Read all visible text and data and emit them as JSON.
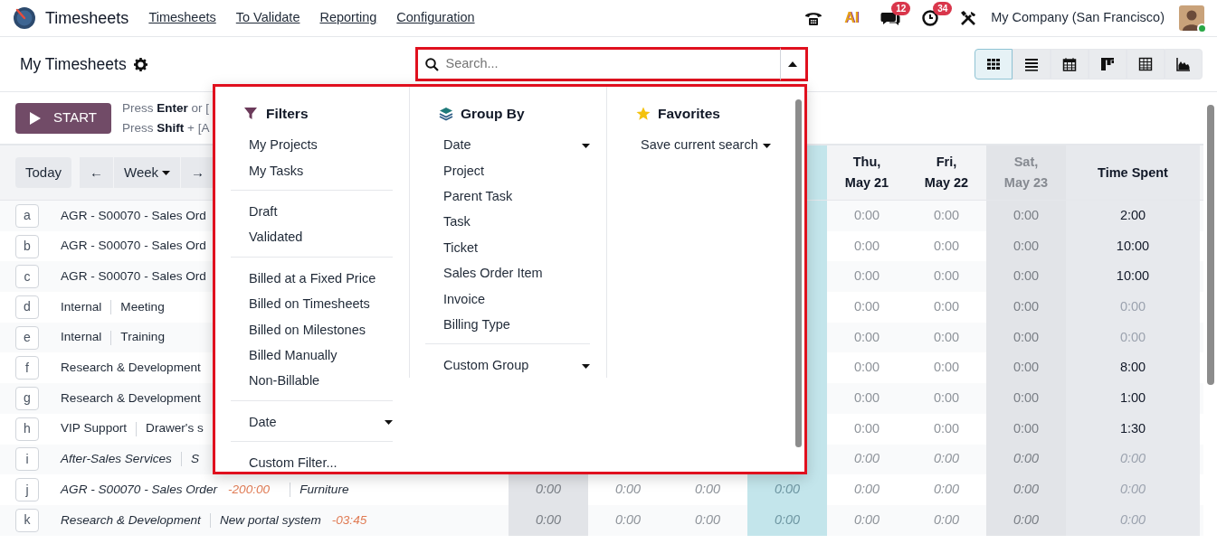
{
  "navbar": {
    "app_name": "Timesheets",
    "menu": [
      "Timesheets",
      "To Validate",
      "Reporting",
      "Configuration"
    ],
    "systray": [
      {
        "kind": "phone"
      },
      {
        "kind": "ai",
        "label": "AI"
      },
      {
        "kind": "chat",
        "badge": "12"
      },
      {
        "kind": "clock",
        "badge": "34"
      },
      {
        "kind": "tools"
      }
    ],
    "company": "My Company (San Francisco)",
    "user": {
      "online": true
    }
  },
  "control_panel": {
    "title": "My Timesheets",
    "search": {
      "placeholder": "Search...",
      "expanded": true
    },
    "views": [
      {
        "kind": "grid",
        "selected": true
      },
      {
        "kind": "list",
        "selected": false
      },
      {
        "kind": "calendar",
        "selected": false
      },
      {
        "kind": "kanban",
        "selected": false
      },
      {
        "kind": "pivot",
        "selected": false
      },
      {
        "kind": "graph",
        "selected": false
      }
    ]
  },
  "timer": {
    "button": "START",
    "hints": [
      "Press **Enter** or [",
      "Press **Shift** + [A"
    ]
  },
  "grid": {
    "toolbar": {
      "today": "Today",
      "prev": "←",
      "range": "Week",
      "next": "→"
    },
    "columns": [
      {
        "weekend": true
      },
      {
        "weekend": false
      },
      {
        "weekend": false
      },
      {
        "today": true
      },
      {
        "label": "Thu,",
        "date": "May 21",
        "weekend": false
      },
      {
        "label": "Fri,",
        "date": "May 22",
        "weekend": false
      },
      {
        "label": "Sat,",
        "date": "May 23",
        "weekend": true
      }
    ],
    "total_header": "Time Spent",
    "rows": [
      {
        "key": "a",
        "kind": "active",
        "segments": [
          {
            "kind": "name",
            "text": "AGR - S00070 - Sales Ord"
          }
        ],
        "hours": [
          "0:00",
          "0:00",
          "0:00"
        ],
        "total": "2:00",
        "total_muted": false
      },
      {
        "key": "b",
        "kind": "active",
        "segments": [
          {
            "kind": "name",
            "text": "AGR - S00070 - Sales Ord"
          }
        ],
        "hours": [
          "0:00",
          "0:00",
          "0:00"
        ],
        "total": "10:00",
        "total_muted": false
      },
      {
        "key": "c",
        "kind": "active",
        "segments": [
          {
            "kind": "name",
            "text": "AGR - S00070 - Sales Ord"
          }
        ],
        "hours": [
          "0:00",
          "0:00",
          "0:00"
        ],
        "total": "10:00",
        "total_muted": false
      },
      {
        "key": "d",
        "kind": "active",
        "segments": [
          {
            "kind": "name",
            "text": "Internal"
          },
          {
            "kind": "name",
            "text": "Meeting"
          }
        ],
        "hours": [
          "0:00",
          "0:00",
          "0:00"
        ],
        "total": "0:00",
        "total_muted": true
      },
      {
        "key": "e",
        "kind": "active",
        "segments": [
          {
            "kind": "name",
            "text": "Internal"
          },
          {
            "kind": "name",
            "text": "Training"
          }
        ],
        "hours": [
          "0:00",
          "0:00",
          "0:00"
        ],
        "total": "0:00",
        "total_muted": true
      },
      {
        "key": "f",
        "kind": "active",
        "segments": [
          {
            "kind": "name",
            "text": "Research & Development"
          }
        ],
        "hours": [
          "0:00",
          "0:00",
          "0:00"
        ],
        "total": "8:00",
        "total_muted": false
      },
      {
        "key": "g",
        "kind": "active",
        "segments": [
          {
            "kind": "name",
            "text": "Research & Development"
          }
        ],
        "hours": [
          "0:00",
          "0:00",
          "0:00"
        ],
        "total": "1:00",
        "total_muted": false
      },
      {
        "key": "h",
        "kind": "active",
        "segments": [
          {
            "kind": "name",
            "text": "VIP Support"
          },
          {
            "kind": "name",
            "text": "Drawer's s"
          }
        ],
        "hours": [
          "0:00",
          "0:00",
          "0:00"
        ],
        "total": "1:30",
        "total_muted": false
      },
      {
        "key": "i",
        "kind": "inactive",
        "segments": [
          {
            "kind": "name",
            "text": "After-Sales Services"
          },
          {
            "kind": "name",
            "text": "S"
          }
        ],
        "hours": [
          "0:00",
          "0:00",
          "0:00"
        ],
        "total": "0:00",
        "total_muted": true
      },
      {
        "key": "j",
        "kind": "inactive",
        "segments": [
          {
            "kind": "name",
            "text": "AGR - S00070 - Sales Order"
          },
          {
            "kind": "remaining",
            "text": "-200:00"
          },
          {
            "kind": "name",
            "text": "Furniture"
          }
        ],
        "hours": [
          "0:00",
          "0:00",
          "0:00",
          "0:00",
          "0:00",
          "0:00",
          "0:00"
        ],
        "total": "0:00",
        "total_muted": true
      },
      {
        "key": "k",
        "kind": "inactive",
        "segments": [
          {
            "kind": "name",
            "text": "Research & Development"
          },
          {
            "kind": "name",
            "text": "New portal system"
          },
          {
            "kind": "remaining",
            "text": "-03:45"
          }
        ],
        "hours": [
          "0:00",
          "0:00",
          "0:00",
          "0:00",
          "0:00",
          "0:00",
          "0:00"
        ],
        "total": "0:00",
        "total_muted": true
      }
    ]
  },
  "search_panel": {
    "filters": {
      "title": "Filters",
      "groups": [
        {
          "items": [
            {
              "label": "My Projects"
            },
            {
              "label": "My Tasks"
            }
          ]
        },
        {
          "items": [
            {
              "label": "Draft"
            },
            {
              "label": "Validated"
            }
          ]
        },
        {
          "items": [
            {
              "label": "Billed at a Fixed Price"
            },
            {
              "label": "Billed on Timesheets"
            },
            {
              "label": "Billed on Milestones"
            },
            {
              "label": "Billed Manually"
            },
            {
              "label": "Non-Billable"
            }
          ]
        },
        {
          "items": [
            {
              "label": "Date",
              "submenu": true
            }
          ]
        },
        {
          "items": [
            {
              "label": "Custom Filter..."
            }
          ]
        }
      ]
    },
    "group_by": {
      "title": "Group By",
      "groups": [
        {
          "items": [
            {
              "label": "Date",
              "submenu": true
            },
            {
              "label": "Project"
            },
            {
              "label": "Parent Task"
            },
            {
              "label": "Task"
            },
            {
              "label": "Ticket"
            },
            {
              "label": "Sales Order Item"
            },
            {
              "label": "Invoice"
            },
            {
              "label": "Billing Type"
            }
          ]
        },
        {
          "items": [
            {
              "label": "Custom Group",
              "submenu": true
            }
          ]
        }
      ]
    },
    "favorites": {
      "title": "Favorites",
      "groups": [
        {
          "items": [
            {
              "label": "Save current search",
              "submenu": true
            }
          ]
        }
      ]
    }
  }
}
